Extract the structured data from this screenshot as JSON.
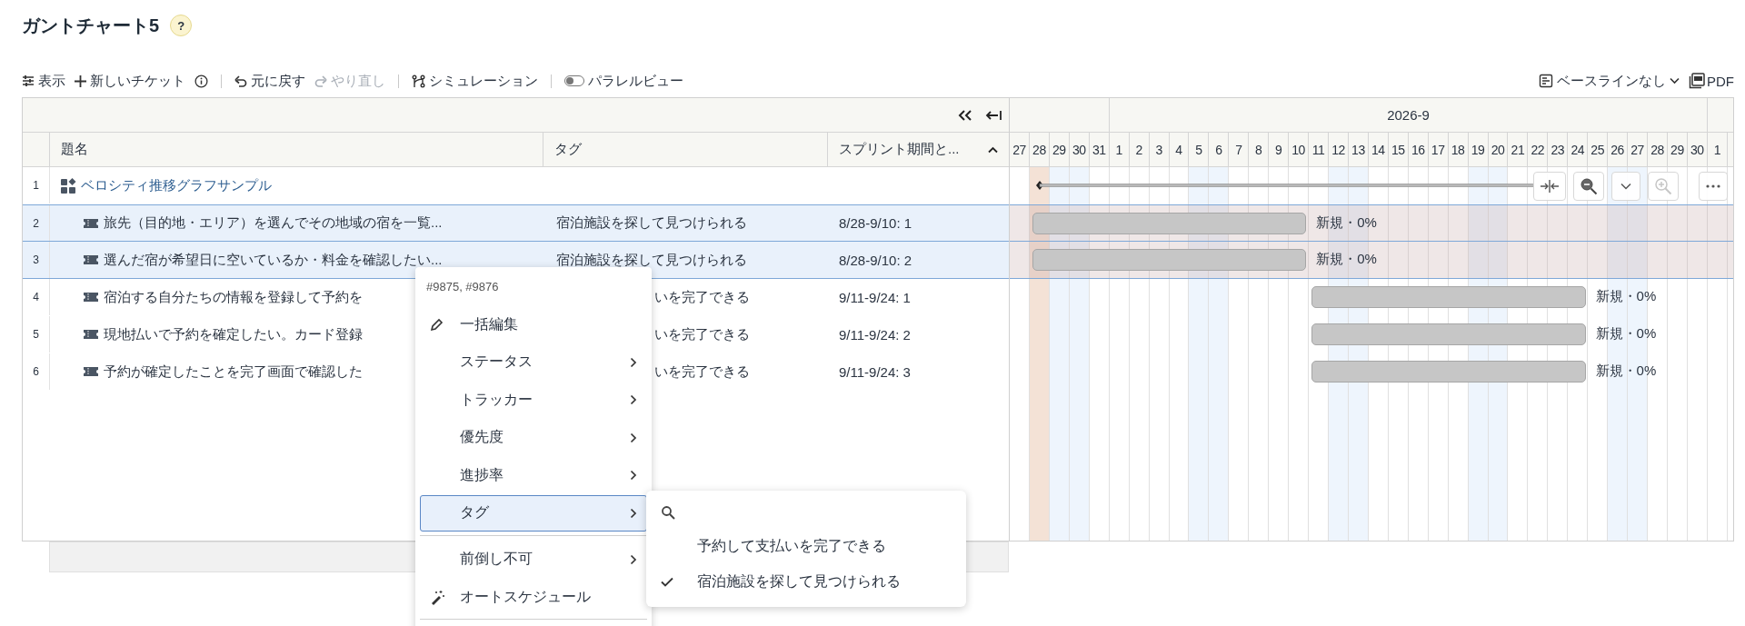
{
  "page": {
    "title": "ガントチャート5",
    "help": "?"
  },
  "toolbar": {
    "view": "表示",
    "new_ticket": "新しいチケット",
    "undo": "元に戻す",
    "redo": {
      "label": "やり直し",
      "disabled": true
    },
    "simulation": "シミュレーション",
    "parallel_view": {
      "label": "パラレルビュー",
      "on": false
    },
    "baseline": "ベースラインなし",
    "pdf": "PDF"
  },
  "table": {
    "columns": [
      "題名",
      "タグ",
      "スプリント期間と..."
    ],
    "rows": [
      {
        "number": "1",
        "title": "ベロシティ推移グラフサンプル",
        "kind": "parent",
        "selected": false,
        "bar": {
          "kind": "summary"
        },
        "children": [
          {
            "number": "2",
            "title": "旅先（目的地・エリア）を選んでその地域の宿を一覧...",
            "tag": "宿泊施設を探して見つけられる",
            "sprint": "8/28-9/10: 1",
            "selected": true,
            "bar": {
              "kind": "task",
              "label": "新規・0%"
            }
          },
          {
            "number": "3",
            "title": "選んだ宿が希望日に空いているか・料金を確認したい...",
            "tag": "宿泊施設を探して見つけられる",
            "sprint": "8/28-9/10: 2",
            "selected": true,
            "bar": {
              "kind": "task",
              "label": "新規・0%"
            }
          },
          {
            "number": "4",
            "title": "宿泊する自分たちの情報を登録して予約を",
            "tag": "いを完了できる",
            "sprint": "9/11-9/24: 1",
            "selected": false,
            "bar": {
              "kind": "task",
              "label": "新規・0%"
            }
          },
          {
            "number": "5",
            "title": "現地払いで予約を確定したい。カード登録",
            "tag": "いを完了できる",
            "sprint": "9/11-9/24: 2",
            "selected": false,
            "bar": {
              "kind": "task",
              "label": "新規・0%"
            }
          },
          {
            "number": "6",
            "title": "予約が確定したことを完了画面で確認した",
            "tag": "いを完了できる",
            "sprint": "9/11-9/24: 3",
            "selected": false,
            "bar": {
              "kind": "task",
              "label": "新規・0%"
            }
          }
        ]
      }
    ]
  },
  "timeline": {
    "segments": [
      {
        "days": [
          {
            "label": "27",
            "kind": "weekday"
          },
          {
            "label": "28",
            "kind": "today"
          },
          {
            "label": "29",
            "kind": "weekend"
          },
          {
            "label": "30",
            "kind": "weekend"
          },
          {
            "label": "31",
            "kind": "weekday"
          }
        ]
      },
      {
        "label": "2026-9",
        "days": [
          {
            "label": "1",
            "kind": "weekday"
          },
          {
            "label": "2",
            "kind": "weekday"
          },
          {
            "label": "3",
            "kind": "weekday"
          },
          {
            "label": "4",
            "kind": "weekday"
          },
          {
            "label": "5",
            "kind": "weekend"
          },
          {
            "label": "6",
            "kind": "weekend"
          },
          {
            "label": "7",
            "kind": "weekday"
          },
          {
            "label": "8",
            "kind": "weekday"
          },
          {
            "label": "9",
            "kind": "weekday"
          },
          {
            "label": "10",
            "kind": "weekday"
          },
          {
            "label": "11",
            "kind": "weekday"
          },
          {
            "label": "12",
            "kind": "weekend"
          },
          {
            "label": "13",
            "kind": "weekend"
          },
          {
            "label": "14",
            "kind": "weekday"
          },
          {
            "label": "15",
            "kind": "weekday"
          },
          {
            "label": "16",
            "kind": "weekday"
          },
          {
            "label": "17",
            "kind": "weekday"
          },
          {
            "label": "18",
            "kind": "weekday"
          },
          {
            "label": "19",
            "kind": "weekend"
          },
          {
            "label": "20",
            "kind": "weekend"
          },
          {
            "label": "21",
            "kind": "weekday"
          },
          {
            "label": "22",
            "kind": "weekday"
          },
          {
            "label": "23",
            "kind": "weekday"
          },
          {
            "label": "24",
            "kind": "weekday"
          },
          {
            "label": "25",
            "kind": "weekday"
          },
          {
            "label": "26",
            "kind": "weekend"
          },
          {
            "label": "27",
            "kind": "weekend"
          },
          {
            "label": "28",
            "kind": "weekday"
          },
          {
            "label": "29",
            "kind": "weekday"
          },
          {
            "label": "30",
            "kind": "weekday"
          }
        ]
      },
      {
        "days": [
          {
            "label": "1",
            "kind": "weekday"
          },
          {
            "kind": "weekday"
          }
        ]
      }
    ],
    "controls": {
      "zoom_in_disabled": true
    }
  },
  "context_menu": {
    "header": "#9875, #9876",
    "items": [
      {
        "kind": "edit",
        "label": "一括編集"
      },
      {
        "kind": "submenu",
        "label": "ステータス",
        "selected": false
      },
      {
        "kind": "submenu",
        "label": "トラッカー",
        "selected": false
      },
      {
        "kind": "submenu",
        "label": "優先度",
        "selected": false
      },
      {
        "kind": "submenu",
        "label": "進捗率",
        "selected": false
      },
      {
        "kind": "submenu",
        "label": "タグ",
        "selected": true
      },
      {
        "kind": "divider"
      },
      {
        "kind": "submenu",
        "label": "前倒し不可",
        "selected": false
      },
      {
        "kind": "auto",
        "label": "オートスケジュール"
      },
      {
        "kind": "divider"
      }
    ],
    "submenu": {
      "options": [
        {
          "label": "予約して支払いを完了できる",
          "checked": false
        },
        {
          "label": "宿泊施設を探して見つけられる",
          "checked": true
        }
      ]
    }
  }
}
